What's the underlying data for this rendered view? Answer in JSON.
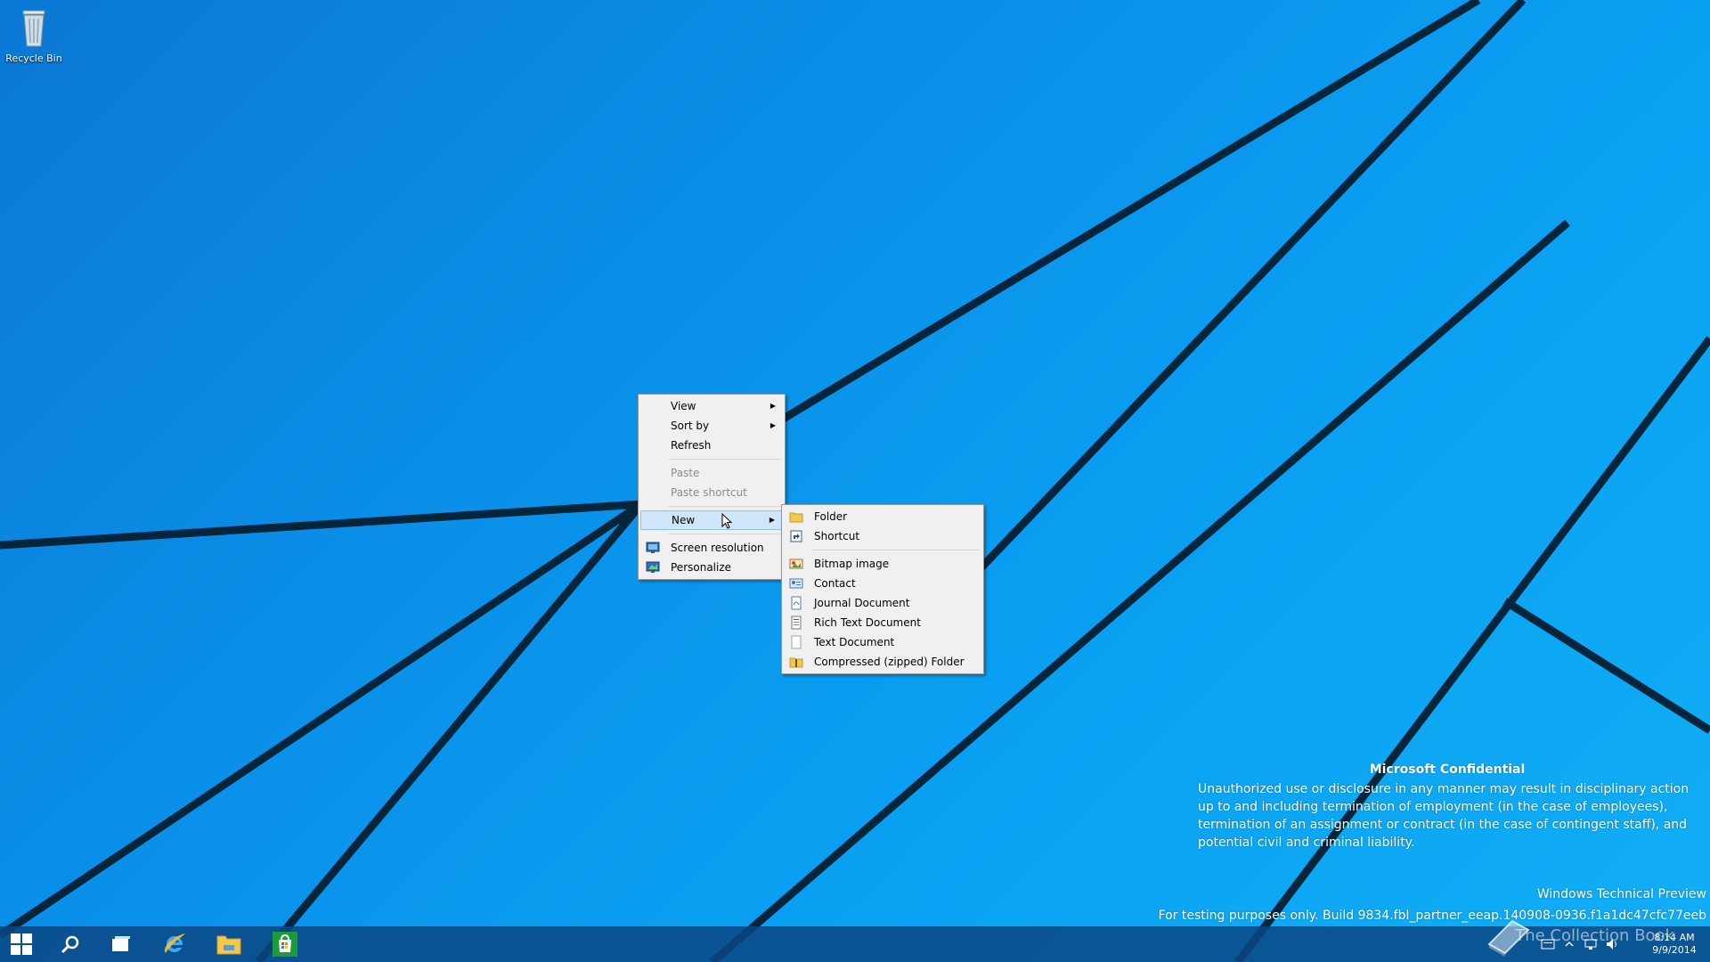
{
  "desktop": {
    "recycle_bin_label": "Recycle Bin"
  },
  "context_menu": {
    "items": [
      {
        "label": "View",
        "has_submenu": true
      },
      {
        "label": "Sort by",
        "has_submenu": true
      },
      {
        "label": "Refresh"
      },
      {
        "label": "Paste",
        "disabled": true
      },
      {
        "label": "Paste shortcut",
        "disabled": true
      },
      {
        "label": "New",
        "has_submenu": true,
        "highlighted": true
      },
      {
        "label": "Screen resolution",
        "icon": "screen-resolution-icon"
      },
      {
        "label": "Personalize",
        "icon": "personalize-icon"
      }
    ]
  },
  "new_submenu": {
    "items": [
      {
        "label": "Folder",
        "icon": "folder-icon"
      },
      {
        "label": "Shortcut",
        "icon": "shortcut-icon"
      },
      {
        "label": "Bitmap image",
        "icon": "bitmap-image-icon"
      },
      {
        "label": "Contact",
        "icon": "contact-icon"
      },
      {
        "label": "Journal Document",
        "icon": "journal-document-icon"
      },
      {
        "label": "Rich Text Document",
        "icon": "rich-text-document-icon"
      },
      {
        "label": "Text Document",
        "icon": "text-document-icon"
      },
      {
        "label": "Compressed (zipped) Folder",
        "icon": "zipped-folder-icon"
      }
    ]
  },
  "watermark": {
    "title": "Microsoft Confidential",
    "body": "Unauthorized use or disclosure in any manner may result in disciplinary action up to and including termination of employment (in the case of employees), termination of an assignment or contract (in the case of contingent staff), and potential civil and criminal liability.",
    "preview": "Windows Technical Preview",
    "build": "For testing purposes only. Build 9834.fbl_partner_eeap.140908-0936.f1a1dc47cfc77eeb"
  },
  "brand_overlay": "The Collection Book",
  "taskbar": {
    "buttons": [
      "start-icon",
      "search-icon",
      "task-view-icon",
      "internet-explorer-icon",
      "file-explorer-icon",
      "store-icon"
    ],
    "clock": {
      "time": "8:14 AM",
      "date": "9/9/2014"
    }
  },
  "colors": {
    "accent": "#0a8fe8",
    "menu_bg": "#f0f0f0",
    "menu_highlight": "#cfe6f9"
  }
}
